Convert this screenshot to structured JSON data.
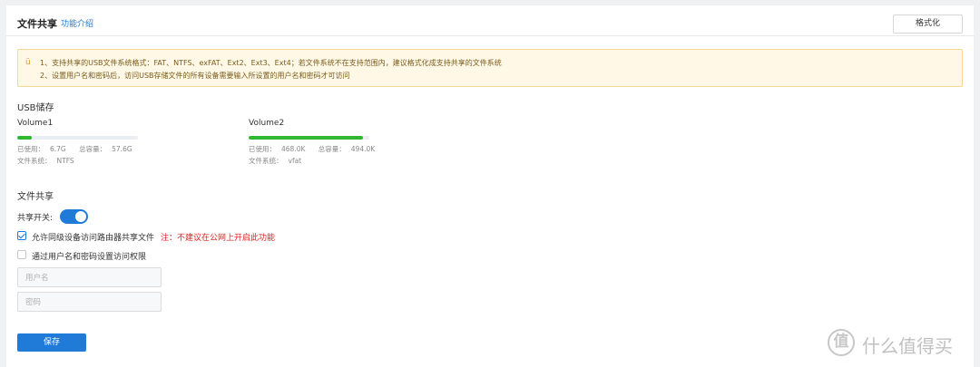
{
  "header": {
    "title": "文件共享",
    "help_link": "功能介绍",
    "format_button": "格式化"
  },
  "notice": {
    "icon": "smile-icon",
    "lines": [
      "1、支持共享的USB文件系统格式：FAT、NTFS、exFAT、Ext2、Ext3、Ext4；若文件系统不在支持范围内，建议格式化成支持共享的文件系统",
      "2、设置用户名和密码后，访问USB存储文件的所有设备需要输入所设置的用户名和密码才可访问"
    ]
  },
  "usb": {
    "section_title": "USB储存",
    "volumes": [
      {
        "name": "Volume1",
        "usage_fraction": 0.12,
        "used_label": "已使用：",
        "used": "6.7G",
        "total_label": "总容量：",
        "total": "57.6G",
        "fs_label": "文件系统：",
        "fs": "NTFS"
      },
      {
        "name": "Volume2",
        "usage_fraction": 0.95,
        "used_label": "已使用：",
        "used": "468.0K",
        "total_label": "总容量：",
        "total": "494.0K",
        "fs_label": "文件系统：",
        "fs": "vfat"
      }
    ],
    "bar_color": "#2fb82f"
  },
  "share": {
    "section_title": "文件共享",
    "toggle_label": "共享开关:",
    "toggle_on": true,
    "allow_lan_label": "允许同级设备访问路由器共享文件",
    "allow_lan_checked": true,
    "warning": "注：不建议在公网上开启此功能",
    "auth_label": "通过用户名和密码设置访问权限",
    "auth_checked": false,
    "username_placeholder": "用户名",
    "password_placeholder": "密码",
    "save_button": "保存"
  },
  "watermark": {
    "logo": "值",
    "text": "什么值得买"
  },
  "colors": {
    "accent": "#1f7ad8",
    "warning_text": "#e02020",
    "notice_bg": "#fff8e6"
  }
}
